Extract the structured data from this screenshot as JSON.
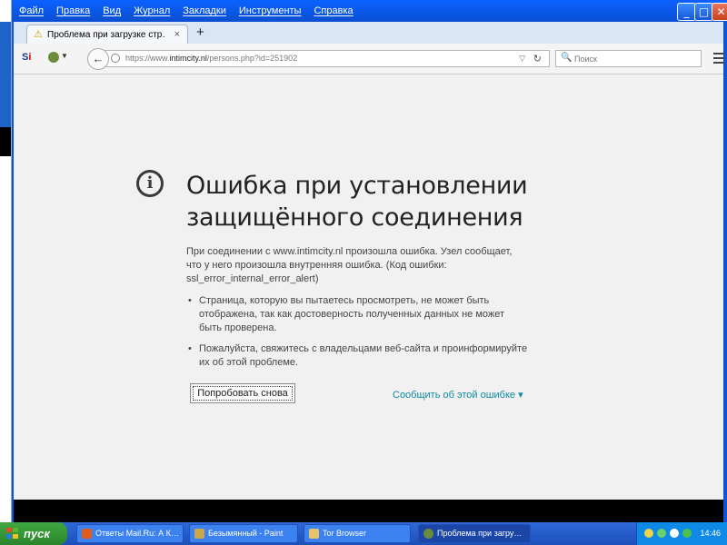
{
  "menu": {
    "items": [
      "Файл",
      "Правка",
      "Вид",
      "Журнал",
      "Закладки",
      "Инструменты",
      "Справка"
    ]
  },
  "window_controls": {
    "minimize": "_",
    "maximize": "□",
    "close": "✕"
  },
  "tab": {
    "title": "Проблема при загрузке стр…",
    "close": "×"
  },
  "new_tab": "+",
  "navbar": {
    "url_prefix": "https://www.",
    "url_domain": "intimcity.nl",
    "url_path": "/persons.php?id=251902",
    "search_placeholder": "Поиск"
  },
  "error": {
    "title_line1": "Ошибка при установлении",
    "title_line2": "защищённого соединения",
    "desc_line1": "При соединении с www.intimcity.nl произошла ошибка. Узел сообщает,",
    "desc_line2": "что у него произошла внутренняя ошибка. (Код ошибки:",
    "desc_line3": "ssl_error_internal_error_alert)",
    "bullet1_line1": "Страница, которую вы пытаетесь просмотреть, не может быть",
    "bullet1_line2": "отображена, так как достоверность полученных данных не может",
    "bullet1_line3": "быть проверена.",
    "bullet2_line1": "Пожалуйста, свяжитесь с владельцами веб-сайта и проинформируйте",
    "bullet2_line2": "их об этой проблеме.",
    "retry_button": "Попробовать снова",
    "report_link": "Сообщить об этой ошибке ▾"
  },
  "taskbar": {
    "start": "пуск",
    "tasks": [
      {
        "label": "Ответы Mail.Ru: А К…",
        "color": "#e25b1a"
      },
      {
        "label": "Безымянный - Paint",
        "color": "#c9a84d"
      },
      {
        "label": "Tor Browser",
        "color": "#e7c46a"
      },
      {
        "label": "Проблема при загру…",
        "color": "#6c8a3c"
      }
    ],
    "clock": "14:46"
  },
  "colors": {
    "titlebar": "#0b61ff",
    "link": "#0c8aa0",
    "page_bg": "#f1f1f1"
  }
}
